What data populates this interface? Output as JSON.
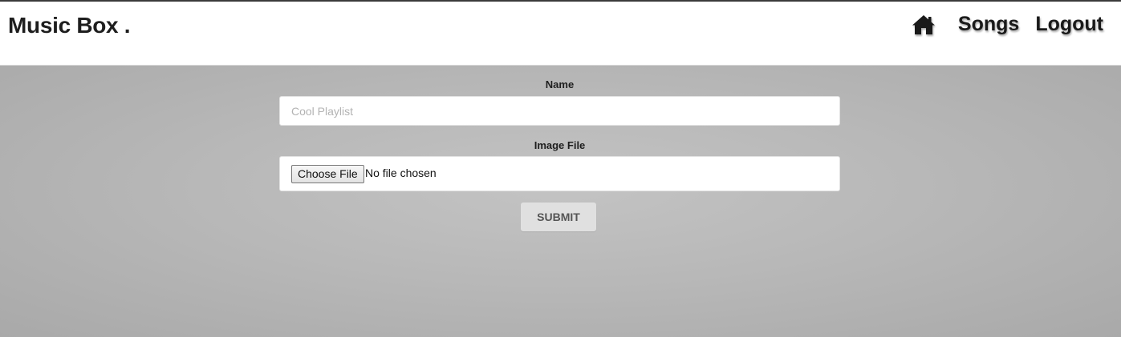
{
  "header": {
    "brand": "Music Box .",
    "nav": {
      "home_icon": "home-icon",
      "songs_label": "Songs",
      "logout_label": "Logout"
    }
  },
  "form": {
    "name_label": "Name",
    "name_value": "",
    "name_placeholder": "Cool Playlist",
    "image_label": "Image File",
    "choose_file_label": "Choose File",
    "file_status": "No file chosen",
    "submit_label": "SUBMIT"
  },
  "colors": {
    "header_bg": "#ffffff",
    "page_bg": "#b8b8b8",
    "submit_bg": "#e0e0e0",
    "text": "#1e1e1e"
  }
}
